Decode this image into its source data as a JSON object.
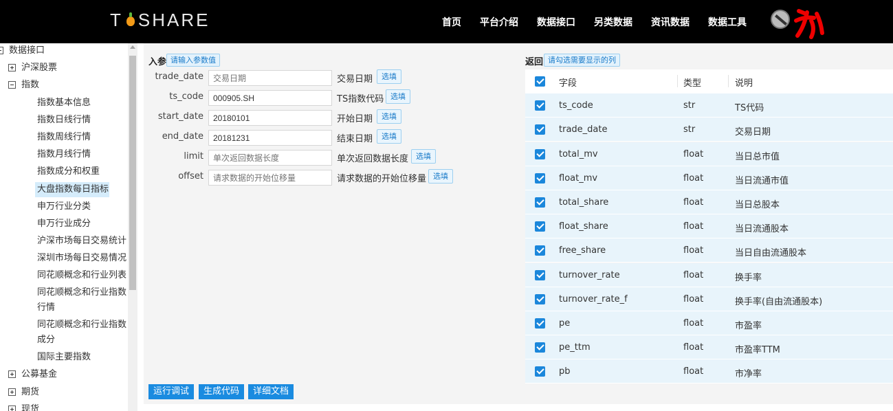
{
  "header": {
    "logo_text": "TUSHARE",
    "nav": [
      "首页",
      "平台介绍",
      "数据接口",
      "另类数据",
      "资讯数据",
      "数据工具"
    ]
  },
  "sidebar": {
    "root": "数据接口",
    "groups": [
      {
        "label": "沪深股票",
        "expanded": false
      },
      {
        "label": "指数",
        "expanded": true
      },
      {
        "label": "公募基金",
        "expanded": false
      },
      {
        "label": "期货",
        "expanded": false
      },
      {
        "label": "现货",
        "expanded": false
      }
    ],
    "index_items": [
      "指数基本信息",
      "指数日线行情",
      "指数周线行情",
      "指数月线行情",
      "指数成分和权重",
      "大盘指数每日指标",
      "申万行业分类",
      "申万行业成分",
      "沪深市场每日交易统计",
      "深圳市场每日交易情况",
      "同花顺概念和行业列表",
      "同花顺概念和行业指数行情",
      "同花顺概念和行业指数成分",
      "国际主要指数"
    ],
    "active_item": "大盘指数每日指标"
  },
  "params": {
    "title": "入参",
    "hint": "请输入参数值",
    "select_label": "选填",
    "rows": [
      {
        "name": "trade_date",
        "value": "",
        "placeholder": "交易日期",
        "desc": "交易日期"
      },
      {
        "name": "ts_code",
        "value": "000905.SH",
        "placeholder": "",
        "desc": "TS指数代码"
      },
      {
        "name": "start_date",
        "value": "20180101",
        "placeholder": "",
        "desc": "开始日期"
      },
      {
        "name": "end_date",
        "value": "20181231",
        "placeholder": "",
        "desc": "结束日期"
      },
      {
        "name": "limit",
        "value": "",
        "placeholder": "单次返回数据长度",
        "desc": "单次返回数据长度"
      },
      {
        "name": "offset",
        "value": "",
        "placeholder": "请求数据的开始位移量",
        "desc": "请求数据的开始位移量"
      }
    ]
  },
  "returns": {
    "title": "返回",
    "hint": "请勾选需要显示的列",
    "columns": [
      "字段",
      "类型",
      "说明"
    ],
    "rows": [
      {
        "field": "ts_code",
        "type": "str",
        "desc": "TS代码"
      },
      {
        "field": "trade_date",
        "type": "str",
        "desc": "交易日期"
      },
      {
        "field": "total_mv",
        "type": "float",
        "desc": "当日总市值"
      },
      {
        "field": "float_mv",
        "type": "float",
        "desc": "当日流通市值"
      },
      {
        "field": "total_share",
        "type": "float",
        "desc": "当日总股本"
      },
      {
        "field": "float_share",
        "type": "float",
        "desc": "当日流通股本"
      },
      {
        "field": "free_share",
        "type": "float",
        "desc": "当日自由流通股本"
      },
      {
        "field": "turnover_rate",
        "type": "float",
        "desc": "换手率"
      },
      {
        "field": "turnover_rate_f",
        "type": "float",
        "desc": "换手率(自由流通股本)"
      },
      {
        "field": "pe",
        "type": "float",
        "desc": "市盈率"
      },
      {
        "field": "pe_ttm",
        "type": "float",
        "desc": "市盈率TTM"
      },
      {
        "field": "pb",
        "type": "float",
        "desc": "市净率"
      }
    ]
  },
  "actions": [
    "运行调试",
    "生成代码",
    "详细文档"
  ],
  "colors": {
    "accent": "#1a8be0",
    "nav_bg": "#000000",
    "row_bg": "#e8f4fb"
  }
}
